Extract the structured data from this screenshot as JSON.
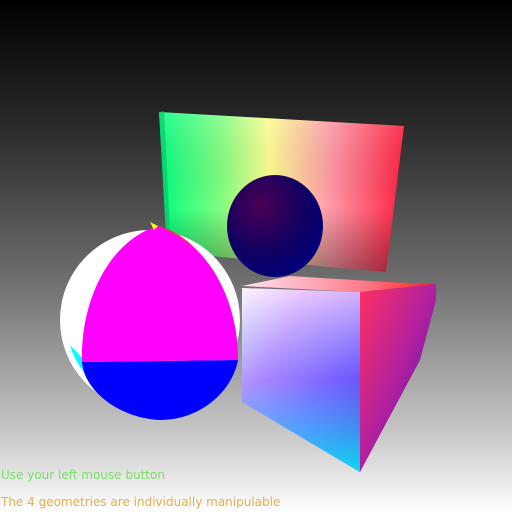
{
  "hud": {
    "line1": "Use your left mouse button",
    "line2": "The 4 geometries are individually manipulable"
  },
  "colors": {
    "line1": "#7bdc6a",
    "line2": "#e3b04b"
  }
}
